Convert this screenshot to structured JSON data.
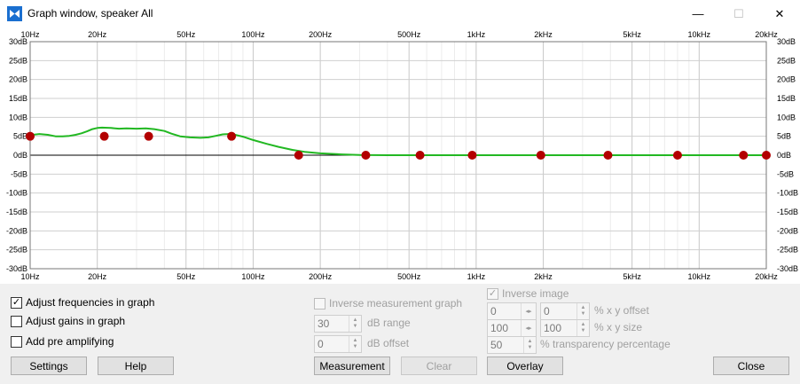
{
  "window": {
    "title": "Graph window, speaker All",
    "minimize_glyph": "—",
    "maximize_glyph": "☐",
    "close_glyph": "✕"
  },
  "graph": {
    "freq_labels": [
      "10Hz",
      "20Hz",
      "50Hz",
      "100Hz",
      "200Hz",
      "500Hz",
      "1kHz",
      "2kHz",
      "5kHz",
      "10kHz",
      "20kHz"
    ],
    "freq_values": [
      10,
      20,
      50,
      100,
      200,
      500,
      1000,
      2000,
      5000,
      10000,
      20000
    ],
    "db_labels": [
      "30dB",
      "25dB",
      "20dB",
      "15dB",
      "10dB",
      "5dB",
      "0dB",
      "-5dB",
      "-10dB",
      "-15dB",
      "-20dB",
      "-25dB",
      "-30dB"
    ],
    "db_values": [
      30,
      25,
      20,
      15,
      10,
      5,
      0,
      -5,
      -10,
      -15,
      -20,
      -25,
      -30
    ],
    "curve_color": "#22b822",
    "point_color": "#b30000",
    "curve": [
      [
        10,
        5.3
      ],
      [
        11,
        5.6
      ],
      [
        12,
        5.4
      ],
      [
        13,
        5.0
      ],
      [
        14,
        5.0
      ],
      [
        15,
        5.1
      ],
      [
        16,
        5.4
      ],
      [
        17,
        5.8
      ],
      [
        18,
        6.3
      ],
      [
        19,
        6.9
      ],
      [
        20,
        7.2
      ],
      [
        21,
        7.3
      ],
      [
        23,
        7.2
      ],
      [
        25,
        7.0
      ],
      [
        27,
        7.1
      ],
      [
        30,
        7.0
      ],
      [
        33,
        7.1
      ],
      [
        36,
        6.9
      ],
      [
        40,
        6.4
      ],
      [
        43,
        5.7
      ],
      [
        47,
        5.0
      ],
      [
        52,
        4.7
      ],
      [
        58,
        4.6
      ],
      [
        63,
        4.7
      ],
      [
        68,
        5.1
      ],
      [
        73,
        5.5
      ],
      [
        78,
        5.6
      ],
      [
        83,
        5.4
      ],
      [
        90,
        4.9
      ],
      [
        100,
        4.0
      ],
      [
        115,
        3.0
      ],
      [
        130,
        2.2
      ],
      [
        150,
        1.4
      ],
      [
        170,
        0.9
      ],
      [
        200,
        0.5
      ],
      [
        250,
        0.2
      ],
      [
        300,
        0.05
      ],
      [
        400,
        0
      ],
      [
        1000,
        0
      ],
      [
        10000,
        0
      ],
      [
        20000,
        0
      ]
    ],
    "points": [
      [
        10,
        5
      ],
      [
        21.5,
        5
      ],
      [
        34,
        5
      ],
      [
        80,
        5
      ],
      [
        160,
        0
      ],
      [
        320,
        0
      ],
      [
        560,
        0
      ],
      [
        960,
        0
      ],
      [
        1950,
        0
      ],
      [
        3900,
        0
      ],
      [
        8000,
        0
      ],
      [
        15800,
        0
      ],
      [
        20000,
        0
      ]
    ]
  },
  "controls": {
    "adjust_freq": {
      "label": "Adjust frequencies in graph",
      "checked": true
    },
    "adjust_gain": {
      "label": "Adjust gains in graph",
      "checked": false
    },
    "pre_amp": {
      "label": "Add pre amplifying",
      "checked": false
    },
    "inverse_meas": {
      "label": "Inverse measurement graph",
      "checked": false
    },
    "db_range": {
      "value": "30",
      "label": "dB range"
    },
    "db_offset": {
      "value": "0",
      "label": "dB offset"
    },
    "inverse_image": {
      "label": "Inverse image",
      "checked": true
    },
    "xy_offset": {
      "x": "0",
      "y": "0",
      "label": "% x y offset"
    },
    "xy_size": {
      "x": "100",
      "y": "100",
      "label": "% x y size"
    },
    "transparency": {
      "value": "50",
      "label": "% transparency percentage"
    }
  },
  "buttons": {
    "settings": "Settings",
    "help": "Help",
    "measurement": "Measurement",
    "clear": "Clear",
    "overlay": "Overlay",
    "close": "Close"
  }
}
